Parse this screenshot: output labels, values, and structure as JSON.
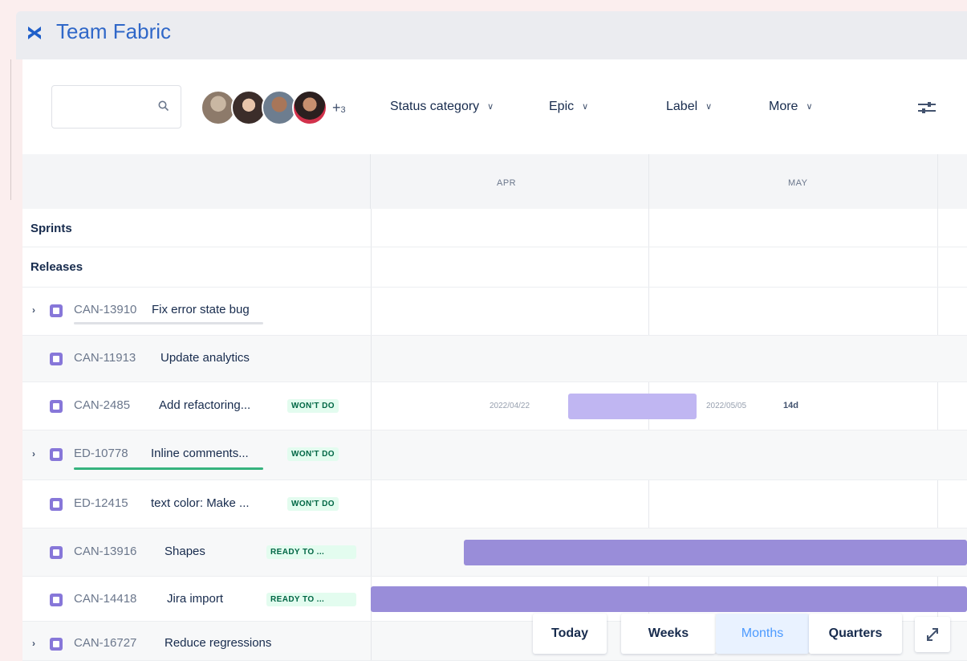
{
  "header": {
    "title": "Team Fabric",
    "logo_icon": "fabric-x-icon"
  },
  "toolbar": {
    "search": {
      "value": "",
      "placeholder": ""
    },
    "avatars": {
      "more_prefix": "+",
      "more_count": "3"
    },
    "filters": [
      {
        "label": "Status category"
      },
      {
        "label": "Epic"
      },
      {
        "label": "Label"
      },
      {
        "label": "More"
      }
    ]
  },
  "timeline": {
    "months": [
      "APR",
      "MAY"
    ]
  },
  "rows": {
    "sprints": "Sprints",
    "releases": "Releases"
  },
  "issues": [
    {
      "key": "CAN-13910",
      "title": "Fix error state bug",
      "status": "",
      "progress": 0
    },
    {
      "key": "CAN-11913",
      "title": "Update analytics",
      "status": ""
    },
    {
      "key": "CAN-2485",
      "title": "Add refactoring...",
      "status": "WON'T DO",
      "start": "2022/04/22",
      "end": "2022/05/05",
      "duration": "14d"
    },
    {
      "key": "ED-10778",
      "title": "Inline comments...",
      "status": "WON'T DO",
      "progress": 1
    },
    {
      "key": "ED-12415",
      "title": "text color: Make ...",
      "status": "WON'T DO"
    },
    {
      "key": "CAN-13916",
      "title": "Shapes",
      "status": "READY TO ..."
    },
    {
      "key": "CAN-14418",
      "title": "Jira import",
      "status": "READY TO ..."
    },
    {
      "key": "CAN-16727",
      "title": "Reduce regressions",
      "status": ""
    }
  ],
  "view_switcher": {
    "options": [
      "Today",
      "Weeks",
      "Months",
      "Quarters"
    ],
    "selected": "Months"
  },
  "colors": {
    "accent": "#2f67c8",
    "bar": "#998dd9",
    "bar_light": "#c0b6f2",
    "lozenge_bg": "#e3fcef",
    "lozenge_fg": "#006644"
  }
}
